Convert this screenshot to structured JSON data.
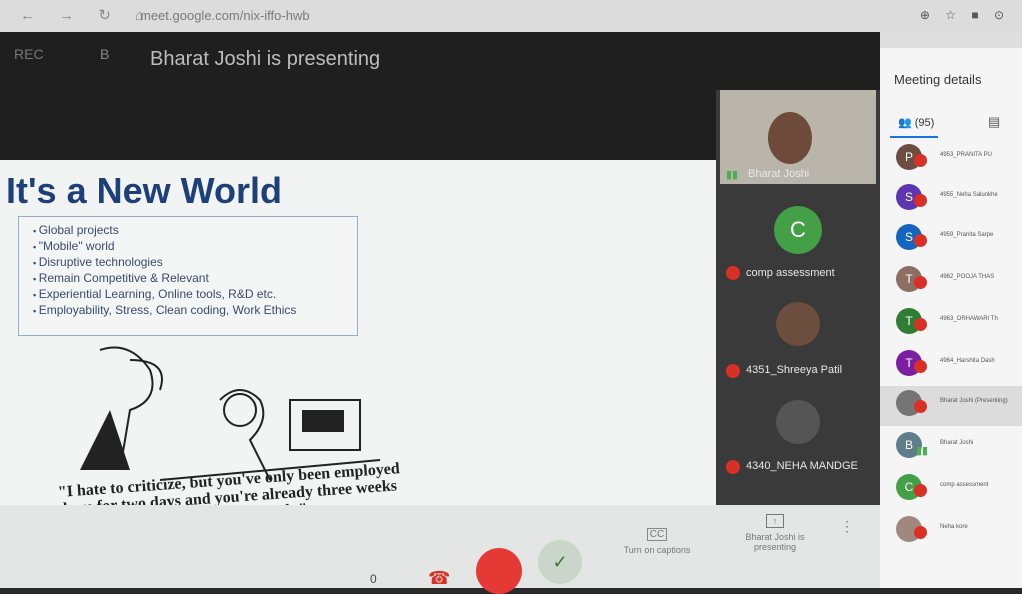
{
  "browser": {
    "url": "meet.google.com/nix-iffo-hwb"
  },
  "header": {
    "rec_label": "REC",
    "presenter_badge": "B",
    "presenting_text": "Bharat Joshi is presenting"
  },
  "slide": {
    "title": "It's a New World",
    "bullets": [
      "Global projects",
      "\"Mobile\" world",
      "Disruptive technologies",
      "Remain Competitive & Relevant",
      "Experiential Learning, Online tools, R&D etc.",
      "Employability, Stress, Clean coding, Work Ethics"
    ],
    "cartoon_caption": "\"I hate to criticize, but you've only been employed here for two days and you're already three weeks behind in your work.\""
  },
  "tiles": [
    {
      "name": "Bharat Joshi"
    },
    {
      "name": "comp assessment",
      "avatar_letter": "C"
    },
    {
      "name": "4351_Shreeya Patil"
    },
    {
      "name": "4340_NEHA MANDGE"
    }
  ],
  "controls": {
    "mic_count": "0",
    "captions_label": "Turn on captions",
    "captions_icon": "CC",
    "present_label": "Bharat Joshi is presenting"
  },
  "panel": {
    "title": "Meeting details",
    "people_count": "(95)",
    "participants": [
      {
        "letter": "P",
        "name": "4953_PRANITA PU",
        "color": "#6d4c41"
      },
      {
        "letter": "S",
        "name": "4955_Neha Salunkhe",
        "color": "#5e35b1"
      },
      {
        "letter": "S",
        "name": "4959_Pranita Sarpe",
        "color": "#1565c0"
      },
      {
        "letter": "T",
        "name": "4962_POOJA THAS",
        "color": "#8d6e63"
      },
      {
        "letter": "T",
        "name": "4963_ORHAWARI Th",
        "color": "#2e7d32"
      },
      {
        "letter": "T",
        "name": "4964_Harshita Dash",
        "color": "#7b1fa2"
      },
      {
        "letter": "",
        "name": "Bharat Joshi (Presenting)",
        "color": "#757575"
      },
      {
        "letter": "B",
        "name": "Bharat Joshi",
        "color": "#607d8b"
      },
      {
        "letter": "C",
        "name": "comp assessment",
        "color": "#43a047"
      },
      {
        "letter": "",
        "name": "Neha kore",
        "color": "#a1887f"
      }
    ]
  }
}
